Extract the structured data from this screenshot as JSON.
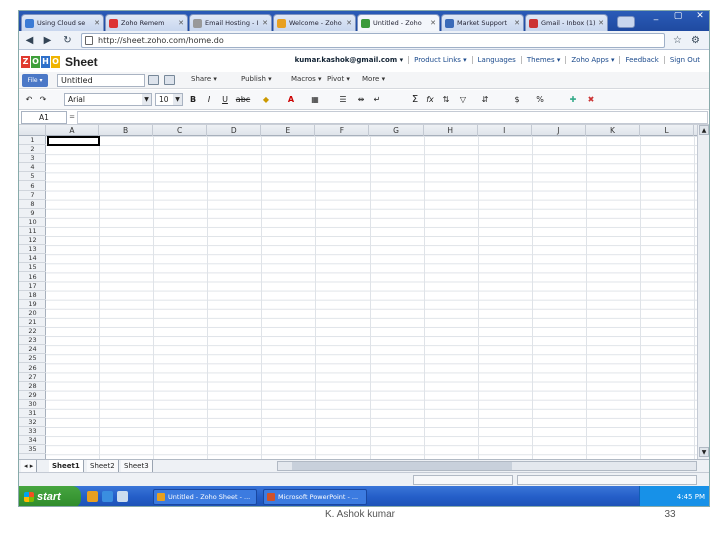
{
  "browser": {
    "tabs": [
      {
        "title": "Using Cloud se",
        "color": "#3a7bd5"
      },
      {
        "title": "Zoho Remem",
        "color": "#d33"
      },
      {
        "title": "Email Hosting - I",
        "color": "#999"
      },
      {
        "title": "Welcome - Zoho",
        "color": "#e8a020"
      },
      {
        "title": "Untitled - Zoho",
        "color": "#3a9a3a",
        "active": true
      },
      {
        "title": "Market Support",
        "color": "#3a6ab8"
      },
      {
        "title": "Gmail - Inbox (1)",
        "color": "#c33"
      }
    ],
    "window_controls": [
      "_",
      "▢",
      "✕"
    ],
    "url": "http://sheet.zoho.com/home.do"
  },
  "zoho": {
    "logo_letters": [
      "Z",
      "O",
      "H",
      "O"
    ],
    "logo_colors": [
      "#e03a2e",
      "#3e9e3a",
      "#2d6fc9",
      "#f0b400"
    ],
    "logo_word": "Sheet",
    "top_links": [
      "kumar.kashok@gmail.com ▾",
      "Product Links ▾",
      "Languages",
      "Themes ▾",
      "Zoho Apps ▾",
      "Feedback",
      "Sign Out"
    ]
  },
  "menubar": {
    "file_label": "File ▾",
    "doc_name": "Untitled",
    "share_label": "Share ▾",
    "publish_label": "Publish ▾",
    "macros_label": "Macros ▾",
    "pivot_label": "Pivot ▾",
    "more_label": "More ▾"
  },
  "format": {
    "font": "Arial",
    "size": "10",
    "bold": "B",
    "italic": "I",
    "underline": "U",
    "strike": "abc",
    "sum": "Σ",
    "fx": "fx"
  },
  "formula": {
    "cell_ref": "A1",
    "fx_label": "="
  },
  "grid": {
    "columns": [
      "A",
      "B",
      "C",
      "D",
      "E",
      "F",
      "G",
      "H",
      "I",
      "J",
      "K",
      "L"
    ],
    "rows": [
      "1",
      "2",
      "3",
      "4",
      "5",
      "6",
      "7",
      "8",
      "9",
      "10",
      "11",
      "12",
      "13",
      "14",
      "15",
      "16",
      "17",
      "18",
      "19",
      "20",
      "21",
      "22",
      "23",
      "24",
      "25",
      "26",
      "27",
      "28",
      "29",
      "30",
      "31",
      "32",
      "33",
      "34",
      "35"
    ]
  },
  "sheets": {
    "tabs": [
      "Sheet1",
      "Sheet2",
      "Sheet3"
    ],
    "active": "Sheet1"
  },
  "taskbar": {
    "start_label": "start",
    "tasks": [
      {
        "label": "Untitled - Zoho Sheet - ...",
        "color": "#e8a020"
      },
      {
        "label": "Microsoft PowerPoint - ...",
        "color": "#d0522a"
      }
    ],
    "clock": "4:45 PM"
  },
  "footer": {
    "author": "K. Ashok kumar",
    "page": "33"
  }
}
